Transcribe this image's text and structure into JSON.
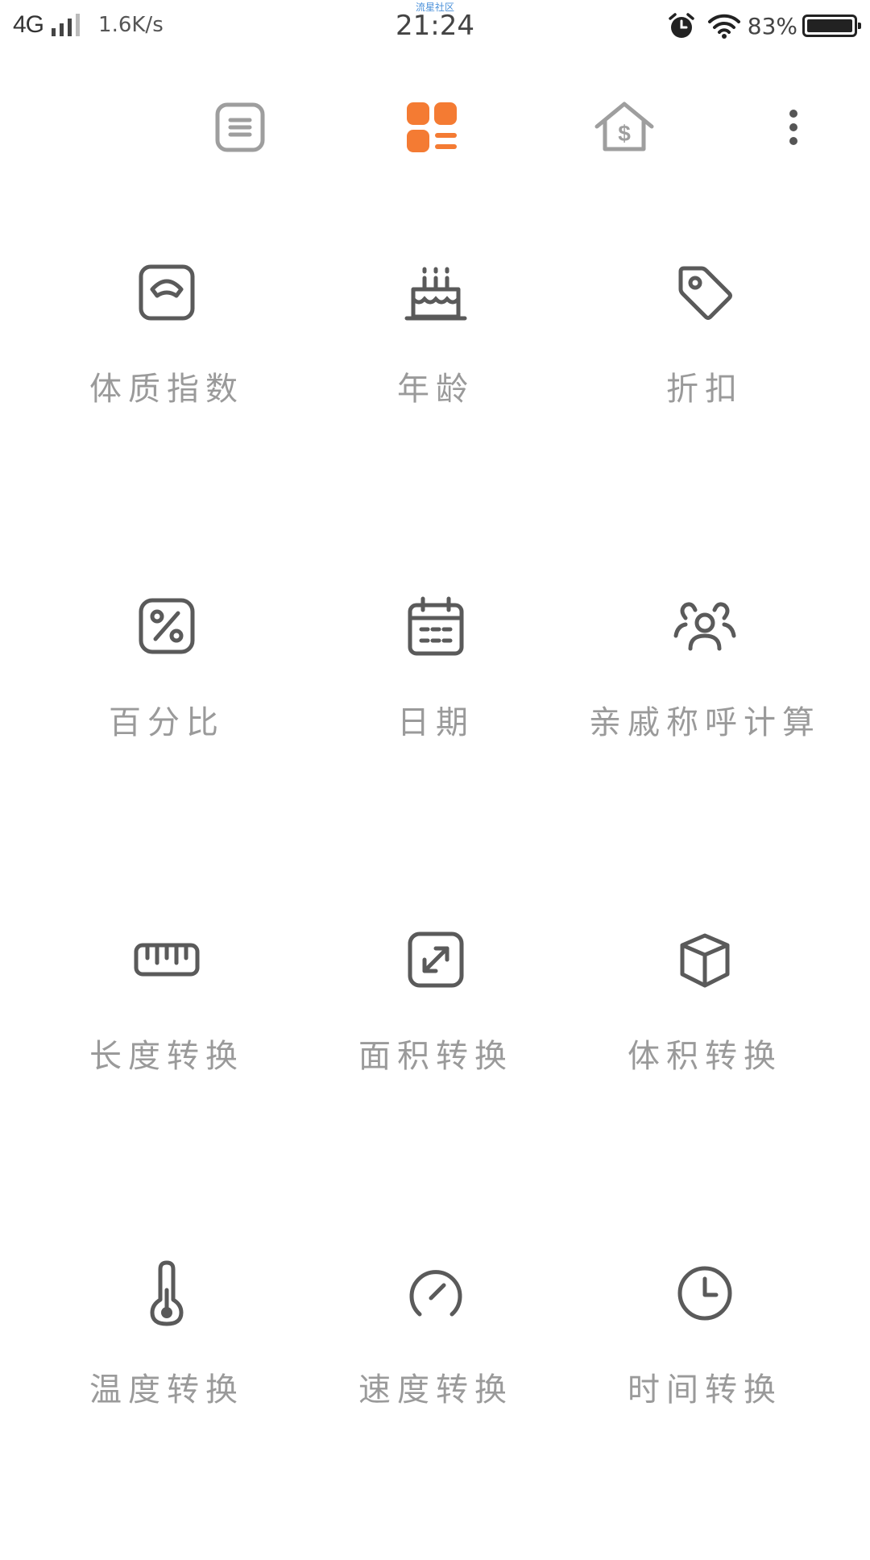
{
  "status_bar": {
    "network": "4G",
    "speed": "1.6K/s",
    "carrier_label": "流星社区",
    "time": "21:24",
    "battery_percent": "83%"
  },
  "toolbar": {
    "icons": [
      "list-icon",
      "grid-icon",
      "house-dollar-icon",
      "more-icon"
    ],
    "active_color": "#f47b33",
    "inactive_color": "#9e9e9e"
  },
  "tools": [
    {
      "label": "体质指数",
      "icon": "scale-icon"
    },
    {
      "label": "年龄",
      "icon": "cake-icon"
    },
    {
      "label": "折扣",
      "icon": "tag-icon"
    },
    {
      "label": "百分比",
      "icon": "percent-icon"
    },
    {
      "label": "日期",
      "icon": "calendar-icon"
    },
    {
      "label": "亲戚称呼计算",
      "icon": "people-icon"
    },
    {
      "label": "长度转换",
      "icon": "ruler-icon"
    },
    {
      "label": "面积转换",
      "icon": "expand-icon"
    },
    {
      "label": "体积转换",
      "icon": "cube-icon"
    },
    {
      "label": "温度转换",
      "icon": "thermometer-icon"
    },
    {
      "label": "速度转换",
      "icon": "speedometer-icon"
    },
    {
      "label": "时间转换",
      "icon": "clock-icon"
    }
  ]
}
